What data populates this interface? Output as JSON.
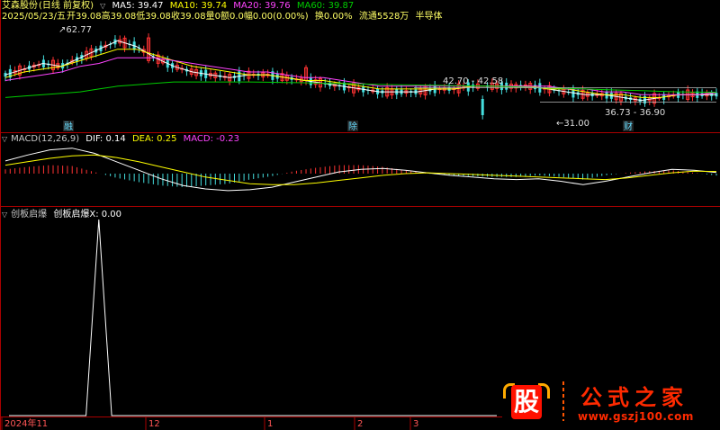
{
  "main_header": {
    "stock_name": "艾森股份",
    "period": "(日线 前复权)",
    "ma5": "MA5: 39.47",
    "ma10": "MA10: 39.74",
    "ma20": "MA20: 39.76",
    "ma60": "MA60: 39.87",
    "colors": {
      "ma5": "#ffffff",
      "ma10": "#ffff00",
      "ma20": "#ff44ff",
      "ma60": "#00cc00"
    }
  },
  "info_line": {
    "date": "2025/05/23/五",
    "open": "开39.08",
    "high": "高39.08",
    "low": "低39.08",
    "close": "收39.08",
    "volume": "量0",
    "amount": "额0.0",
    "change": "幅0.00(0.00%)",
    "turnover": "换0.00%",
    "float": "流通5528万",
    "sector": "半导体"
  },
  "markers": {
    "high_label": "62.77",
    "range1": "42.70 - 42.58",
    "low_label": "31.00",
    "range2": "36.73 - 36.90",
    "tag1": "融",
    "tag2": "除",
    "tag3": "财"
  },
  "macd_header": {
    "title": "MACD(12,26,9)",
    "dif": "DIF: 0.14",
    "dea": "DEA: 0.25",
    "macd": "MACD: -0.23"
  },
  "signal_header": {
    "title": "创板启爆",
    "line": "创板启爆X: 0.00"
  },
  "x_axis": {
    "labels": [
      "2024年11",
      "12",
      "1",
      "2",
      "3"
    ]
  },
  "watermark": {
    "logo_char": "股",
    "name": "公式之家",
    "url": "www.gszj100.com"
  },
  "chart_data": [
    {
      "type": "candlestick",
      "title": "艾森股份 (日线 前复权)",
      "series": [
        {
          "name": "MA5",
          "values": [
            46,
            48,
            50,
            49,
            52,
            55,
            58,
            56,
            52,
            49,
            47,
            46,
            45,
            46,
            46,
            45,
            44,
            43,
            42,
            41,
            40,
            40,
            40,
            41,
            41,
            42,
            42,
            42,
            42,
            41,
            40,
            39,
            39,
            38,
            37,
            38,
            39,
            39,
            39
          ]
        },
        {
          "name": "MA10",
          "values": [
            45,
            47,
            48,
            49,
            51,
            53,
            55,
            55,
            53,
            51,
            49,
            48,
            47,
            46,
            46,
            45,
            44,
            44,
            43,
            42,
            41,
            41,
            41,
            41,
            41,
            42,
            42,
            42,
            42,
            41,
            41,
            40,
            39,
            39,
            38,
            38,
            39,
            39,
            39.74
          ]
        },
        {
          "name": "MA20",
          "values": [
            44,
            45,
            46,
            47,
            49,
            50,
            52,
            52,
            52,
            51,
            50,
            49,
            48,
            47,
            47,
            46,
            45,
            45,
            44,
            43,
            42,
            42,
            42,
            42,
            42,
            42,
            42,
            42,
            42,
            42,
            41,
            41,
            40,
            40,
            39,
            39,
            39,
            39,
            39.76
          ]
        },
        {
          "name": "MA60",
          "values": [
            38,
            38.5,
            39,
            39.5,
            40,
            41,
            42,
            42.5,
            43,
            43.5,
            43.5,
            43.5,
            43.5,
            43.5,
            43.4,
            43.3,
            43.2,
            43,
            42.9,
            42.8,
            42.6,
            42.5,
            42.4,
            42.3,
            42.2,
            42.1,
            42,
            41.8,
            41.6,
            41.4,
            41.2,
            41,
            40.8,
            40.6,
            40.4,
            40.2,
            40,
            39.9,
            39.87
          ]
        }
      ],
      "annotations": [
        "62.77",
        "42.70 - 42.58",
        "31.00",
        "36.73 - 36.90"
      ]
    },
    {
      "type": "bar",
      "title": "MACD(12,26,9)",
      "series": [
        {
          "name": "DIF",
          "values": [
            1.5,
            2.2,
            2.8,
            3.0,
            2.4,
            1.4,
            0.4,
            -0.6,
            -1.4,
            -1.8,
            -2.0,
            -1.9,
            -1.6,
            -1.0,
            -0.4,
            0.2,
            0.5,
            0.6,
            0.4,
            0.1,
            -0.2,
            -0.4,
            -0.6,
            -0.7,
            -0.6,
            -0.9,
            -1.3,
            -0.9,
            -0.4,
            0.1,
            0.5,
            0.4,
            0.14
          ]
        },
        {
          "name": "DEA",
          "values": [
            1.0,
            1.4,
            1.8,
            2.1,
            2.2,
            1.9,
            1.4,
            0.8,
            0.2,
            -0.4,
            -0.8,
            -1.2,
            -1.3,
            -1.3,
            -1.1,
            -0.8,
            -0.5,
            -0.2,
            0.0,
            0.1,
            0.0,
            -0.1,
            -0.2,
            -0.3,
            -0.4,
            -0.5,
            -0.6,
            -0.7,
            -0.5,
            -0.2,
            0.1,
            0.3,
            0.25
          ]
        },
        {
          "name": "MACD",
          "values": [
            0.5,
            0.8,
            1.0,
            0.9,
            0.2,
            -0.5,
            -1.0,
            -1.4,
            -1.6,
            -1.4,
            -1.2,
            -0.7,
            -0.3,
            0.3,
            0.7,
            1.0,
            1.0,
            0.8,
            0.4,
            0.0,
            -0.2,
            -0.3,
            -0.4,
            -0.4,
            -0.2,
            -0.4,
            -0.7,
            -0.2,
            0.1,
            0.3,
            0.4,
            0.1,
            -0.23
          ]
        }
      ]
    },
    {
      "type": "line",
      "title": "创板启爆",
      "series": [
        {
          "name": "创板启爆X",
          "values": [
            0,
            0,
            0,
            0,
            0,
            0,
            0,
            1,
            0,
            0,
            0,
            0,
            0,
            0,
            0,
            0,
            0,
            0,
            0,
            0,
            0,
            0,
            0,
            0,
            0,
            0,
            0,
            0,
            0,
            0,
            0,
            0,
            0,
            0,
            0,
            0,
            0,
            0,
            0
          ]
        }
      ],
      "ylim": [
        0,
        1
      ]
    }
  ]
}
